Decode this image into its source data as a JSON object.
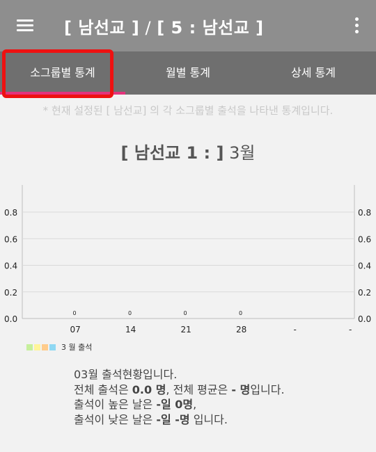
{
  "appbar": {
    "title_main": "[ 남선교 ]",
    "title_sep": " / ",
    "title_sub": "[ 5 : 남선교 ]"
  },
  "tabs": [
    {
      "label": "소그룹별 통계",
      "selected": true
    },
    {
      "label": "월별 통계",
      "selected": false
    },
    {
      "label": "상세 통계",
      "selected": false
    }
  ],
  "notice": "* 현재 설정된 [ 남선교] 의 각 소그룹별 출석을 나타낸 통계입니다.",
  "chart_title": {
    "group": "[ 남선교 1 : ]",
    "month": " 3월"
  },
  "chart_data": {
    "type": "bar",
    "categories": [
      "07",
      "14",
      "21",
      "28",
      "-",
      "-"
    ],
    "values": [
      0,
      0,
      0,
      0
    ],
    "value_labels": [
      "0",
      "0",
      "0",
      "0"
    ],
    "y_ticks": [
      "0.0",
      "0.2",
      "0.4",
      "0.6",
      "0.8"
    ],
    "ylim": [
      0,
      0.8
    ],
    "grid": true,
    "legend_position": "bottom-left",
    "legend_label": "3 월 출석",
    "legend_colors": [
      "#c6ef9c",
      "#fff59a",
      "#ffcc8c",
      "#8fd8f3"
    ]
  },
  "summary": {
    "line1": "03월 출석현황입니다.",
    "line2_prefix": "전체 출석은 ",
    "line2_total": "0.0 명",
    "line2_mid": ", 전체 평균은 ",
    "line2_avg": "- 명",
    "line2_suffix": "입니다.",
    "line3_prefix": "출석이 높은 날은 ",
    "line3_day": "-일 0명",
    "line3_suffix": ",",
    "line4_prefix": "출석이 낮은 날은 ",
    "line4_day": "-일 -명",
    "line4_suffix": " 입니다."
  }
}
